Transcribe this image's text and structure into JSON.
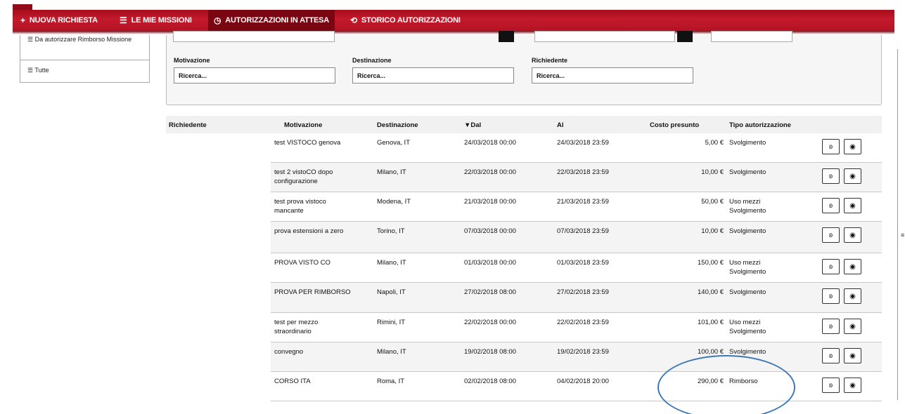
{
  "nav": {
    "items": [
      {
        "icon": "+",
        "label": "NUOVA RICHIESTA"
      },
      {
        "icon": "☰",
        "label": "LE MIE MISSIONI"
      },
      {
        "icon": "◷",
        "label": "AUTORIZZAZIONI IN ATTESA"
      },
      {
        "icon": "⟲",
        "label": "STORICO AUTORIZZAZIONI"
      }
    ]
  },
  "sidebar": {
    "item1": "☰ Da autorizzare Rimborso Missione",
    "item2": "☰ Tutte"
  },
  "filters": {
    "motivazione_label": "Motivazione",
    "destinazione_label": "Destinazione",
    "richiedente_label": "Richiedente",
    "placeholder": "Ricerca..."
  },
  "table": {
    "headers": {
      "richiedente": "Richiedente",
      "motivazione": "Motivazione",
      "destinazione": "Destinazione",
      "dal": "▼Dal",
      "al": "Al",
      "costo": "Costo presunto",
      "tipo": "Tipo autorizzazione"
    },
    "rows": [
      {
        "motivazione": "test VISTOCO genova",
        "destinazione": "Genova, IT",
        "dal": "24/03/2018 00:00",
        "al": "24/03/2018 23:59",
        "costo": "5,00 €",
        "tipo": "Svolgimento"
      },
      {
        "motivazione": "test 2 vistoCO dopo configurazione",
        "destinazione": "Milano, IT",
        "dal": "22/03/2018 00:00",
        "al": "22/03/2018 23:59",
        "costo": "10,00 €",
        "tipo": "Svolgimento"
      },
      {
        "motivazione": "test prova vistoco mancante",
        "destinazione": "Modena, IT",
        "dal": "21/03/2018 00:00",
        "al": "21/03/2018 23:59",
        "costo": "50,00 €",
        "tipo": "Uso mezzi Svolgimento"
      },
      {
        "motivazione": "prova estensioni a zero",
        "destinazione": "Torino, IT",
        "dal": "07/03/2018 00:00",
        "al": "07/03/2018 23:59",
        "costo": "10,00 €",
        "tipo": "Svolgimento"
      },
      {
        "motivazione": "PROVA VISTO CO",
        "destinazione": "Milano, IT",
        "dal": "01/03/2018 00:00",
        "al": "01/03/2018 23:59",
        "costo": "150,00 €",
        "tipo": "Uso mezzi Svolgimento"
      },
      {
        "motivazione": "PROVA PER RIMBORSO",
        "destinazione": "Napoli, IT",
        "dal": "27/02/2018 08:00",
        "al": "27/02/2018 23:59",
        "costo": "140,00 €",
        "tipo": "Svolgimento"
      },
      {
        "motivazione": "test per mezzo straordinario",
        "destinazione": "Rimini, IT",
        "dal": "22/02/2018 00:00",
        "al": "22/02/2018 23:59",
        "costo": "101,00 €",
        "tipo": "Uso mezzi Svolgimento"
      },
      {
        "motivazione": "convegno",
        "destinazione": "Milano, IT",
        "dal": "19/02/2018 08:00",
        "al": "19/02/2018 23:59",
        "costo": "100,00 €",
        "tipo": "Svolgimento"
      },
      {
        "motivazione": "CORSO ITA",
        "destinazione": "Roma, IT",
        "dal": "02/02/2018 08:00",
        "al": "04/02/2018 20:00",
        "costo": "290,00 €",
        "tipo": "Rimborso"
      }
    ]
  },
  "actions": {
    "approve_icon": "ʚ",
    "view_icon": "◉"
  },
  "colors": {
    "nav_red": "#c31a2c",
    "nav_active": "#7a0611",
    "highlight_circle": "#3d78b8"
  }
}
